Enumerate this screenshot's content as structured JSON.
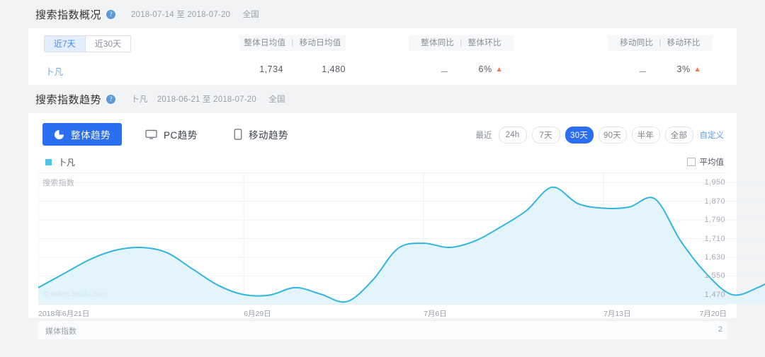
{
  "overview": {
    "title": "搜索指数概况",
    "help_icon": "help-circle-icon",
    "date_range": "2018-07-14 至 2018-07-20",
    "region": "全国",
    "tabs": [
      {
        "label": "近7天",
        "active": true
      },
      {
        "label": "近30天",
        "active": false
      }
    ],
    "columns": [
      {
        "left": "整体日均值",
        "sep": "|",
        "right": "移动日均值"
      },
      {
        "left": "整体同比",
        "sep": "|",
        "right": "整体环比"
      },
      {
        "left": "移动同比",
        "sep": "|",
        "right": "移动环比"
      }
    ],
    "keyword": "卜凡",
    "values": {
      "overall_daily_avg": "1,734",
      "mobile_daily_avg": "1,480",
      "overall_yoy": "－",
      "overall_mom": "6%",
      "overall_mom_dir": "up",
      "mobile_yoy": "－",
      "mobile_mom": "3%",
      "mobile_mom_dir": "up"
    }
  },
  "trend": {
    "title": "搜索指数趋势",
    "help_icon": "help-circle-icon",
    "keyword": "卜凡",
    "date_range": "2018-06-21 至 2018-07-20",
    "region": "全国",
    "modes": [
      {
        "label": "整体趋势",
        "icon": "pie-chart-icon",
        "active": true
      },
      {
        "label": "PC趋势",
        "icon": "monitor-icon",
        "active": false
      },
      {
        "label": "移动趋势",
        "icon": "mobile-icon",
        "active": false
      }
    ],
    "range_label": "最近",
    "ranges": [
      {
        "label": "24h",
        "active": false
      },
      {
        "label": "7天",
        "active": false
      },
      {
        "label": "30天",
        "active": true
      },
      {
        "label": "90天",
        "active": false
      },
      {
        "label": "半年",
        "active": false
      },
      {
        "label": "全部",
        "active": false
      }
    ],
    "custom_label": "自定义",
    "legend_keyword": "卜凡",
    "average_label": "平均值",
    "media_label": "媒体指数",
    "media_value": "2",
    "watermark": "© index.baidu.com",
    "accent_blue": "#2b6ef2",
    "line_color": "#31b5e0",
    "fill_color": "#e4f4fb"
  },
  "chart_data": {
    "type": "area",
    "title": "搜索指数",
    "ylabel": "搜索指数",
    "xlabel": "",
    "grid": true,
    "legend": [
      "卜凡"
    ],
    "legend_position": "top-left",
    "ylim": [
      1430,
      1990
    ],
    "yticks": [
      "1,950",
      "1,870",
      "1,790",
      "1,710",
      "1,630",
      "1,550",
      "1,470"
    ],
    "ytick_values": [
      1950,
      1870,
      1790,
      1710,
      1630,
      1550,
      1470
    ],
    "xticks": [
      "2018年6月21日",
      "6月29日",
      "7月6日",
      "7月13日",
      "7月20日"
    ],
    "xtick_index": [
      0,
      8,
      15,
      22,
      29
    ],
    "series": [
      {
        "name": "卜凡",
        "x": [
          "2018-06-21",
          "2018-06-22",
          "2018-06-23",
          "2018-06-24",
          "2018-06-25",
          "2018-06-26",
          "2018-06-27",
          "2018-06-28",
          "2018-06-29",
          "2018-06-30",
          "2018-07-01",
          "2018-07-02",
          "2018-07-03",
          "2018-07-04",
          "2018-07-05",
          "2018-07-06",
          "2018-07-07",
          "2018-07-08",
          "2018-07-09",
          "2018-07-10",
          "2018-07-11",
          "2018-07-12",
          "2018-07-13",
          "2018-07-14",
          "2018-07-15",
          "2018-07-16",
          "2018-07-17",
          "2018-07-18",
          "2018-07-19",
          "2018-07-20"
        ],
        "values": [
          1500,
          1560,
          1620,
          1660,
          1672,
          1650,
          1580,
          1510,
          1470,
          1468,
          1500,
          1472,
          1440,
          1530,
          1668,
          1690,
          1672,
          1700,
          1760,
          1830,
          1930,
          1860,
          1840,
          1845,
          1880,
          1700,
          1560,
          1470,
          1500,
          1560
        ]
      }
    ]
  }
}
